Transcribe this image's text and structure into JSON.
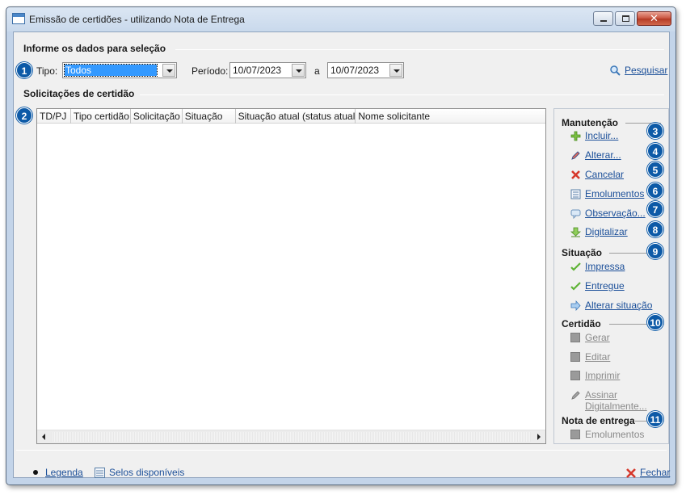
{
  "window": {
    "title": "Emissão de certidões - utilizando Nota de Entrega"
  },
  "selection": {
    "section_title": "Informe os dados para seleção",
    "badge": "1",
    "tipo_label": "Tipo:",
    "tipo_value": "Todos",
    "periodo_label": "Período:",
    "date_from": "10/07/2023",
    "date_sep": "a",
    "date_to": "10/07/2023",
    "search_label": "Pesquisar"
  },
  "requests": {
    "section_title": "Solicitações de certidão",
    "badge": "2",
    "columns": [
      "TD/PJ",
      "Tipo certidão",
      "Solicitação",
      "Situação",
      "Situação atual (status atual)",
      "Nome solicitante"
    ]
  },
  "manutencao": {
    "title": "Manutenção",
    "items": [
      {
        "label": "Incluir...",
        "badge": "3",
        "icon": "plus-icon"
      },
      {
        "label": "Alterar...",
        "badge": "4",
        "icon": "pencil-icon"
      },
      {
        "label": "Cancelar",
        "badge": "5",
        "icon": "x-icon"
      },
      {
        "label": "Emolumentos",
        "badge": "6",
        "icon": "list-icon"
      },
      {
        "label": "Observação...",
        "badge": "7",
        "icon": "comment-icon"
      },
      {
        "label": "Digitalizar",
        "badge": "8",
        "icon": "download-icon"
      }
    ]
  },
  "situacao": {
    "title": "Situação",
    "badge": "9",
    "items": [
      {
        "label": "Impressa",
        "icon": "check-icon"
      },
      {
        "label": "Entregue",
        "icon": "check-icon"
      },
      {
        "label": "Alterar situação",
        "icon": "arrow-right-icon"
      }
    ]
  },
  "certidao": {
    "title": "Certidão",
    "badge": "10",
    "items": [
      {
        "label": "Gerar",
        "icon": "square-icon"
      },
      {
        "label": "Editar",
        "icon": "square-icon"
      },
      {
        "label": "Imprimir",
        "icon": "square-icon"
      },
      {
        "label": "Assinar",
        "label2": "Digitalmente...",
        "icon": "pen-icon"
      }
    ]
  },
  "nota": {
    "title": "Nota de entrega",
    "badge": "11",
    "items": [
      {
        "label": "Emolumentos",
        "icon": "square-icon"
      }
    ]
  },
  "footer": {
    "legend": "Legenda",
    "selos": "Selos disponíveis",
    "close": "Fechar"
  },
  "colors": {
    "badge": "#0d5aa7",
    "link": "#1b4f99",
    "selection": "#3399ff"
  }
}
